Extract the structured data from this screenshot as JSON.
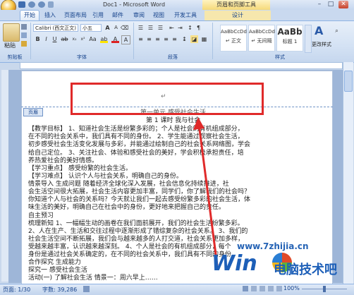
{
  "window": {
    "title": "Doc1 - Microsoft Word",
    "context_tab_group": "页眉和页脚工具",
    "minimize": "–",
    "maximize": "□",
    "close": "✕"
  },
  "tabs": [
    {
      "label": "开始",
      "active": true
    },
    {
      "label": "插入"
    },
    {
      "label": "页面布局"
    },
    {
      "label": "引用"
    },
    {
      "label": "邮件"
    },
    {
      "label": "审阅"
    },
    {
      "label": "视图"
    },
    {
      "label": "开发工具"
    },
    {
      "label": "设计",
      "contextual": true
    }
  ],
  "ribbon": {
    "paste_label": "粘贴",
    "font_name": "Calibri (西文正文)",
    "font_size": "小五",
    "font_group": "字体",
    "paragraph_group": "段落",
    "styles_group": "样式",
    "clipboard_group": "剪贴板",
    "styles": [
      {
        "sample": "AaBbCcDd",
        "name": "↵ 正文"
      },
      {
        "sample": "AaBbCcDd",
        "name": "↵ 无间隔"
      },
      {
        "sample": "AaBb",
        "name": "标题 1"
      }
    ],
    "change_styles": "更改样式"
  },
  "document": {
    "header_tag": "页眉",
    "lines": [
      "第一单元 感受社会生活",
      "第 1 课时 我与社会",
      "【教学目标】    1、知道社会生活是纷繁多彩的；个人是社会的有机组成部分，",
      "在不同的社会关系中，我们具有不同的身份。 2、学生能通过观察社会生活，",
      "初步感受社会生活变化发展与多彩，并能通过绘制自己的社会关系网络图，学会",
      "给自己定位。   3、关注社会、体验和感受社会的美好，学会积极承担责任，培",
      "养热爱社会的美好情感。",
      "【学习重点】  感受纷繁的社会生活。",
      "【学习难点】  认识个人与社会关系，明确自己的身份。",
      "    情景导入  生成问题   随着经济全球化深入发展，社会信息化持续推进，社",
      "会生活空间很大拓展，社会生活内容更加丰富，同学们，你了解我们的社会吗？",
      "你知道个人与社会的关系吗？今天就让我们一起去感受纷繁多彩的社会生活，体",
      "味生活的美好，明确自己在社会中的身份，更好地来把握自己的责任。",
      "自主预习",
      "梳理新知  1、一幅幅生动的画卷在我们面前展开，我们的社会生活纷繁多彩。",
      "2、人在生产、生活和交往过程中逐渐形成了错综复杂的社会关系。  3、我们的",
      "社会生活空间不断拓展，我们会与越来越多的人打交道，社会关系更加多样，",
      "受越来越丰富，认识越来越深刻。  4、个人是社会的有机组成部分，每个",
      "身份是通过社会关系确定的，在不同的社会关系中，我们具有不同的身份。",
      "合作探究  生成能力",
      "探究一  感受社会生活",
      "活动(一) 了解社会生活  情景一：周六早上……"
    ]
  },
  "status": {
    "page": "页面: 1/30",
    "words": "字数: 39,286",
    "zoom": "100%"
  },
  "watermark": {
    "site": "www.7zhijia.cn",
    "brand_cn": "电脑技术吧",
    "win_text": "Win"
  }
}
